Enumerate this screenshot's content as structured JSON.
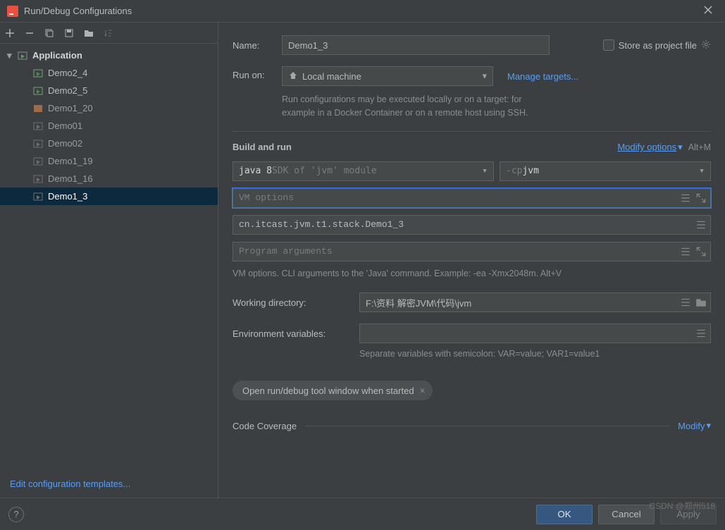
{
  "title": "Run/Debug Configurations",
  "sidebar": {
    "group": "Application",
    "items": [
      {
        "label": "Demo2_4",
        "visible": true
      },
      {
        "label": "Demo2_5",
        "visible": true
      },
      {
        "label": "Demo1_20",
        "special": true
      },
      {
        "label": "Demo01",
        "visible": false
      },
      {
        "label": "Demo02",
        "visible": false
      },
      {
        "label": "Demo1_19",
        "visible": false
      },
      {
        "label": "Demo1_16",
        "visible": false
      },
      {
        "label": "Demo1_3",
        "visible": false,
        "selected": true
      }
    ],
    "edit_templates": "Edit configuration templates..."
  },
  "form": {
    "name_label": "Name:",
    "name_value": "Demo1_3",
    "store_label": "Store as project file",
    "run_on_label": "Run on:",
    "run_on_value": "Local machine",
    "manage_targets": "Manage targets...",
    "run_on_hint1": "Run configurations may be executed locally or on a target: for",
    "run_on_hint2": "example in a Docker Container or on a remote host using SSH.",
    "build_title": "Build and run",
    "modify_options": "Modify options",
    "modify_hint": "Alt+M",
    "jdk_prefix": "java 8 ",
    "jdk_module": "SDK of 'jvm' module",
    "cp_prefix": "-cp ",
    "cp_value": "jvm",
    "vm_placeholder": "VM options",
    "main_class": "cn.itcast.jvm.t1.stack.Demo1_3",
    "prog_args_placeholder": "Program arguments",
    "vm_hint": "VM options. CLI arguments to the 'Java' command. Example: -ea -Xmx2048m. Alt+V",
    "wd_label": "Working directory:",
    "wd_value": "F:\\资料 解密JVM\\代码\\jvm",
    "env_label": "Environment variables:",
    "env_hint": "Separate variables with semicolon: VAR=value; VAR1=value1",
    "open_chip": "Open run/debug tool window when started",
    "coverage_title": "Code Coverage",
    "coverage_modify": "Modify"
  },
  "footer": {
    "ok": "OK",
    "cancel": "Cancel",
    "apply": "Apply"
  },
  "watermark": "CSDN @郑州518"
}
